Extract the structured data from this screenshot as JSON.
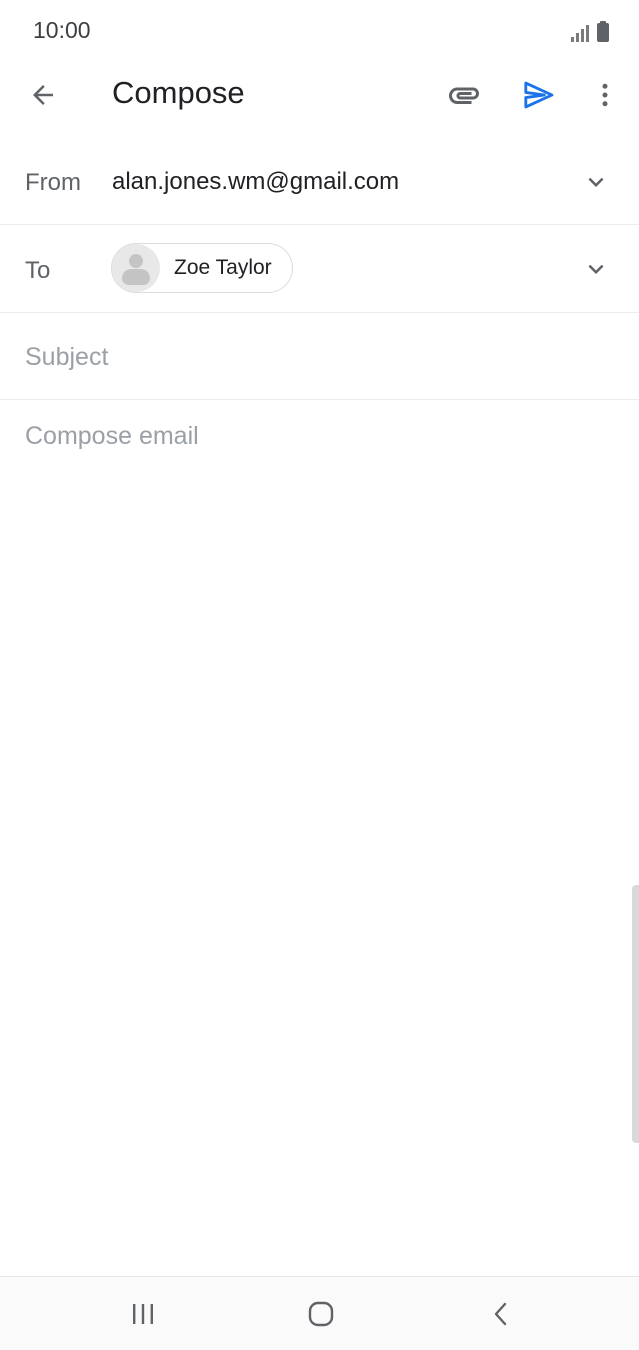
{
  "status_bar": {
    "time": "10:00",
    "icons": [
      "signal-icon",
      "battery-icon"
    ]
  },
  "app_bar": {
    "title": "Compose",
    "icons": [
      "back-arrow-icon",
      "paperclip-icon",
      "send-icon",
      "more-vert-icon"
    ]
  },
  "from": {
    "label": "From",
    "value": "alan.jones.wm@gmail.com"
  },
  "to": {
    "label": "To",
    "recipient": "Zoe Taylor"
  },
  "subject": {
    "placeholder": "Subject",
    "value": ""
  },
  "body": {
    "placeholder": "Compose email",
    "value": ""
  },
  "nav_bar": {
    "icons": [
      "recents-icon",
      "home-icon",
      "nav-back-icon"
    ]
  },
  "colors": {
    "accent": "#1a73e8",
    "icon_gray": "#5f6368",
    "text": "#202124",
    "placeholder": "#9aa0a6"
  }
}
